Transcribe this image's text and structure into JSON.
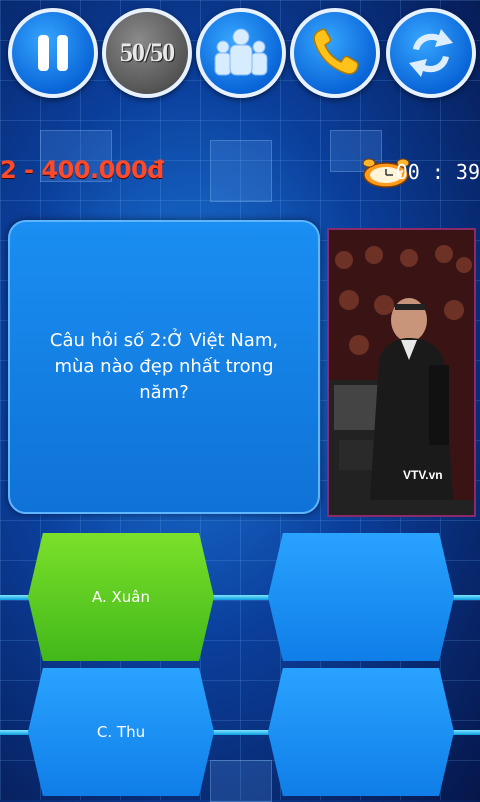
{
  "lifelines": [
    {
      "id": "pause",
      "icon": "pause-icon"
    },
    {
      "id": "fifty_fifty",
      "label": "50/50",
      "icon": "fifty-fifty-icon"
    },
    {
      "id": "ask_audience",
      "icon": "audience-icon"
    },
    {
      "id": "phone_friend",
      "icon": "phone-icon"
    },
    {
      "id": "switch_question",
      "icon": "switch-icon"
    }
  ],
  "prize": "2 - 400.000đ",
  "timer": "00 : 39",
  "question": "Câu hỏi số 2:Ở Việt Nam, mùa nào đẹp nhất trong năm?",
  "host_photo": {
    "icon": "host-photo-image",
    "watermark": "VTV.vn"
  },
  "answers": [
    {
      "key": "A",
      "label": "A. Xuân",
      "selected": true
    },
    {
      "key": "B",
      "label": "",
      "selected": false
    },
    {
      "key": "C",
      "label": "C. Thu",
      "selected": false
    },
    {
      "key": "D",
      "label": "",
      "selected": false
    }
  ],
  "colors": {
    "prize": "#ff4a2a",
    "selected_answer": "#4cc21c",
    "answer": "#1b8cf0",
    "lifeline": "#0a66d8",
    "lifeline_used": "#555555"
  }
}
